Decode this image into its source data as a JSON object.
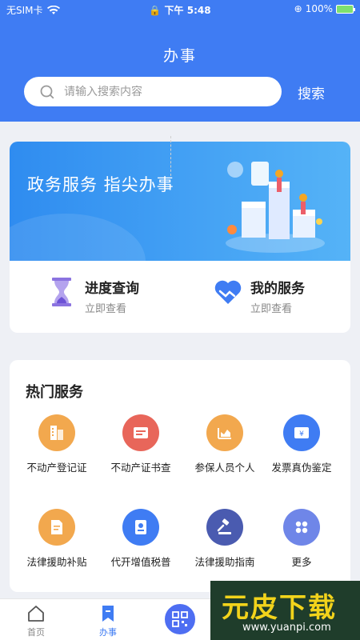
{
  "status_bar": {
    "carrier": "无SIM卡",
    "time": "下午 5:48",
    "battery": "100%"
  },
  "header": {
    "title": "办事",
    "search_placeholder": "请输入搜索内容",
    "search_button": "搜索"
  },
  "banner": {
    "slogan": "政务服务  指尖办事"
  },
  "quick_actions": [
    {
      "title": "进度查询",
      "subtitle": "立即查看",
      "icon": "hourglass-icon"
    },
    {
      "title": "我的服务",
      "subtitle": "立即查看",
      "icon": "heart-icon"
    }
  ],
  "hot_services": {
    "title": "热门服务",
    "items": [
      {
        "label": "不动产登记证",
        "icon": "building-icon",
        "color": "#f2a84e"
      },
      {
        "label": "不动产证书查",
        "icon": "certificate-icon",
        "color": "#e8665a"
      },
      {
        "label": "参保人员个人",
        "icon": "chart-icon",
        "color": "#f2a84e"
      },
      {
        "label": "发票真伪鉴定",
        "icon": "invoice-icon",
        "color": "#3f7cf3"
      },
      {
        "label": "法律援助补贴",
        "icon": "document-icon",
        "color": "#f2a84e"
      },
      {
        "label": "代开增值税普",
        "icon": "tax-icon",
        "color": "#3f7cf3"
      },
      {
        "label": "法律援助指南",
        "icon": "gavel-icon",
        "color": "#4a5bb0"
      },
      {
        "label": "更多",
        "icon": "more-icon",
        "color": "#6f86e8"
      }
    ]
  },
  "tabbar": {
    "home": "首页",
    "services": "办事"
  },
  "watermark": {
    "text_big": "元皮下载",
    "text_small": "www.yuanpi.com"
  }
}
